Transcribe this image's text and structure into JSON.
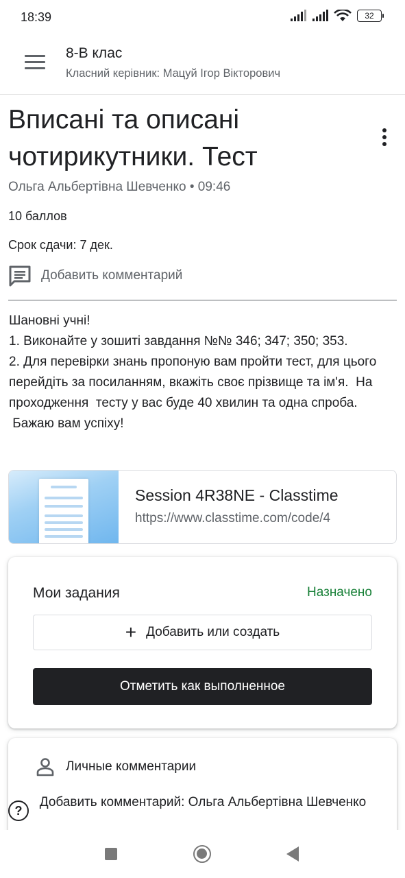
{
  "status_bar": {
    "time": "18:39",
    "battery": "32",
    "icons": [
      "signal-icon",
      "signal-icon",
      "wifi-icon",
      "battery-icon"
    ]
  },
  "app_bar": {
    "menu_icon": "menu-icon",
    "class_name": "8-В клас",
    "teacher": "Класний керівник: Мацуй Ігор Вікторович"
  },
  "assignment": {
    "title": "Вписані та описані чотирикутники. Тест",
    "meta": "Ольга Альбертівна Шевченко • 09:46",
    "points": "10 баллов",
    "due": "Срок сдачи: 7 дек.",
    "add_comment": "Добавить комментарий",
    "description": "Шановні учні!\n1. Виконайте у зошиті завдання №№ 346; 347; 350; 353.\n2. Для перевірки знань пропоную вам пройти тест, для цього перейдіть за посиланням, вкажіть своє прізвище та ім'я.  На проходження  тесту у вас буде 40 хвилин та одна спроба.\n Бажаю вам успіху!"
  },
  "attachment": {
    "title": "Session 4R38NE - Classtime",
    "url": "https://www.classtime.com/code/4"
  },
  "my_work": {
    "title": "Мои задания",
    "status": "Назначено",
    "status_color": "#188038",
    "add_label": "Добавить или создать",
    "mark_done_label": "Отметить как выполненное"
  },
  "private_comments": {
    "title": "Личные комментарии",
    "add_label": "Добавить комментарий: Ольга Альбертівна Шевченко"
  },
  "help": {
    "label": "?"
  }
}
